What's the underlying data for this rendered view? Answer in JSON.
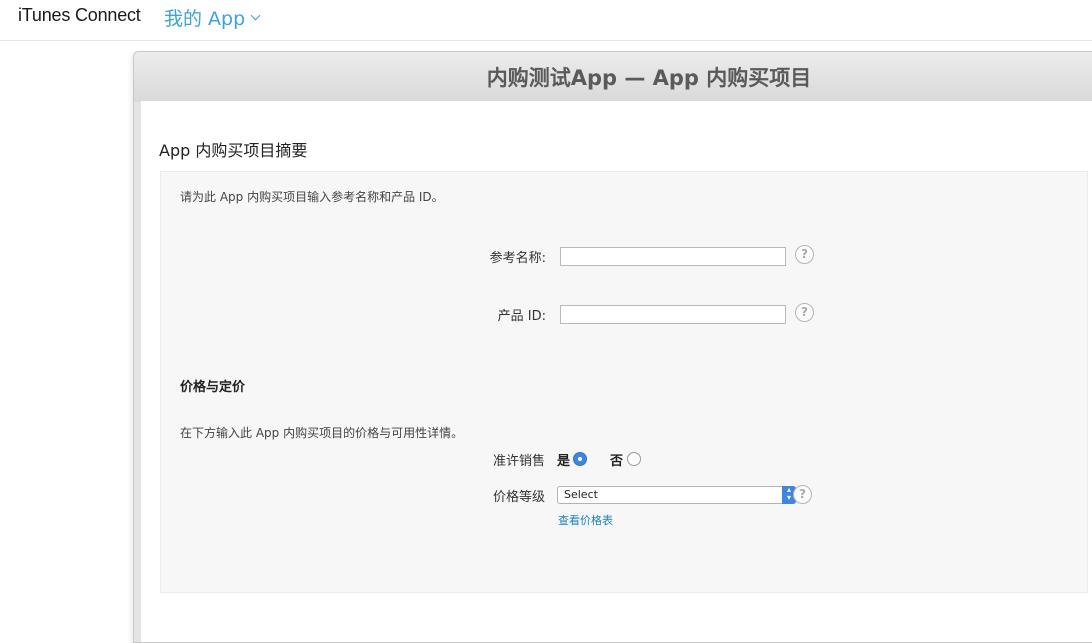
{
  "topbar": {
    "brand": "iTunes Connect",
    "my_apps": "我的 App"
  },
  "modal": {
    "title": "内购测试App — App 内购买项目"
  },
  "summary": {
    "section_title": "App 内购买项目摘要",
    "intro": "请为此 App 内购买项目输入参考名称和产品 ID。",
    "reference_name_label": "参考名称:",
    "reference_name_value": "",
    "product_id_label": "产品 ID:",
    "product_id_value": "",
    "help_glyph": "?"
  },
  "pricing": {
    "heading": "价格与定价",
    "intro": "在下方输入此 App 内购买项目的价格与可用性详情。",
    "cleared_for_sale_label": "准许销售",
    "yes_label": "是",
    "no_label": "否",
    "cleared_for_sale_selected": "是",
    "price_tier_label": "价格等级",
    "price_tier_value": "Select",
    "view_pricing_matrix": "查看价格表"
  },
  "colors": {
    "accent": "#3aa3e3",
    "link": "#1a82c9",
    "radio_selected": "#3b87e8"
  }
}
